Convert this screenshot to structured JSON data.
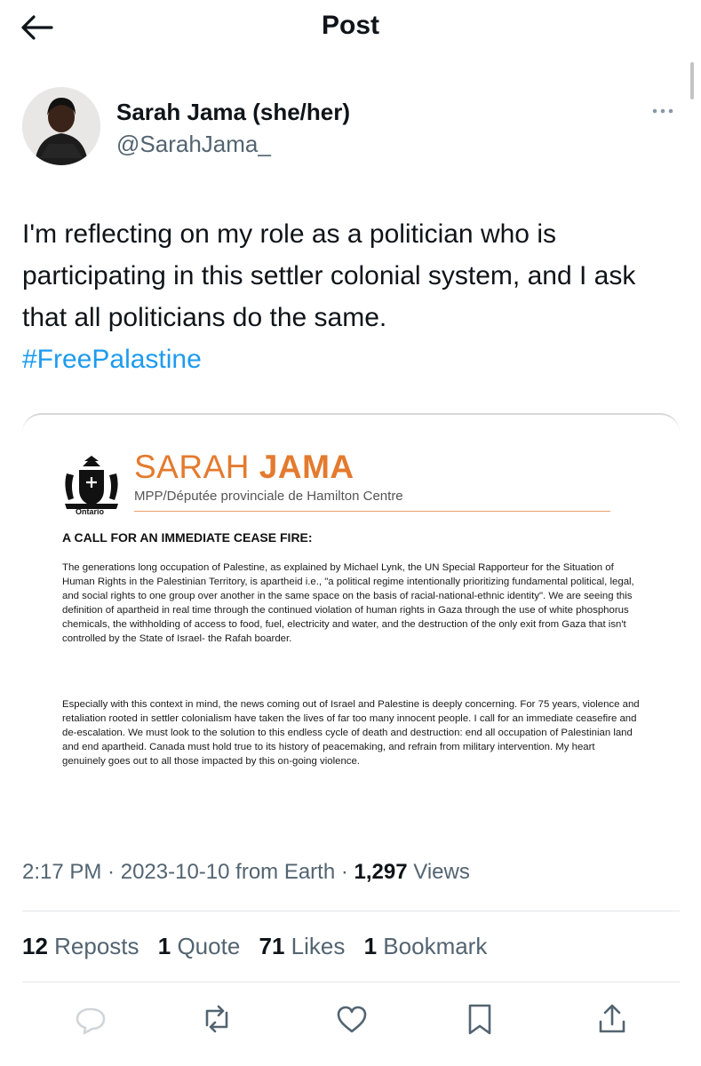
{
  "header": {
    "title": "Post"
  },
  "author": {
    "name": "Sarah Jama (she/her)",
    "handle": "@SarahJama_"
  },
  "tweet": {
    "text": "I'm reflecting on my role as a politician who is participating in this settler colonial system, and I ask that all politicians do the same.",
    "hashtag": "#FreePalastine"
  },
  "document": {
    "crest_label": "Ontario",
    "brand_first": "SARAH",
    "brand_last": "JAMA",
    "subtitle": "MPP/Députée provinciale de Hamilton Centre",
    "heading": "A CALL FOR AN IMMEDIATE CEASE FIRE:",
    "paragraphs": [
      "The generations long occupation of Palestine, as explained by Michael Lynk, the UN Special Rapporteur for the Situation of Human Rights in the Palestinian Territory, is apartheid i.e., \"a political regime intentionally prioritizing fundamental political, legal, and social rights to one group over another in the same space on the basis of racial-national-ethnic identity\". We are seeing this definition of apartheid in real time through the continued violation of human rights in Gaza through the use of white phosphorus chemicals, the withholding of access to food, fuel, electricity and water, and the destruction of the only exit from Gaza that isn't controlled by the State of Israel- the Rafah boarder.",
      "Especially with this context in mind, the news coming out of Israel and Palestine is deeply concerning. For 75 years, violence and retaliation rooted in settler colonialism have taken the lives of far too many innocent people. I call for an immediate ceasefire and de-escalation. We must look to the solution to this endless cycle of death and destruction: end all occupation of Palestinian land and end apartheid. Canada must hold true to its history of peacemaking, and refrain from military intervention. My heart genuinely goes out to all those impacted by this on-going violence."
    ]
  },
  "meta": {
    "time": "2:17 PM",
    "separator": " · ",
    "date": "2023-10-10",
    "source": " from Earth",
    "views_count": "1,297",
    "views_label": " Views"
  },
  "stats": {
    "reposts_count": "12",
    "reposts_label": " Reposts",
    "quotes_count": "1",
    "quotes_label": " Quote",
    "likes_count": "71",
    "likes_label": " Likes",
    "bookmarks_count": "1",
    "bookmarks_label": " Bookmark"
  },
  "colors": {
    "accent": "#1d9bf0",
    "brand_orange": "#e47a2e",
    "muted": "#536471"
  },
  "icons": [
    "back-arrow-icon",
    "more-icon",
    "reply-icon",
    "repost-icon",
    "like-icon",
    "bookmark-icon",
    "share-icon"
  ]
}
